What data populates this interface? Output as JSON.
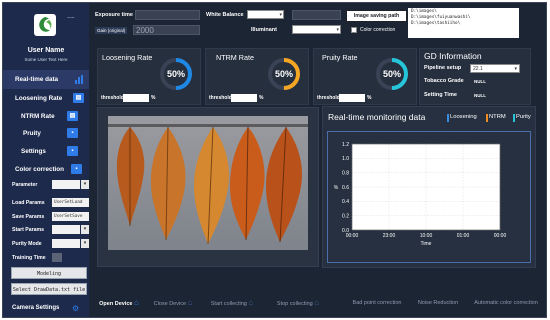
{
  "sidebar": {
    "dots": "........",
    "user_name": "User Name",
    "user_subtitle": "Some User Text Here",
    "nav": [
      {
        "label": "Real-time data",
        "icon": "chart-icon"
      },
      {
        "label": "Loosening Rate",
        "icon": "image-icon"
      },
      {
        "label": "NTRM Rate",
        "icon": "image-icon"
      },
      {
        "label": "Pruity",
        "icon": "square-icon"
      },
      {
        "label": "Settings",
        "icon": "square-icon"
      },
      {
        "label": "Color correction",
        "icon": "square-icon"
      }
    ],
    "params": [
      {
        "label": "Parameter",
        "value": ""
      },
      {
        "label": "Load Params",
        "value": "UserSetLoad"
      },
      {
        "label": "Save Params",
        "value": "UserSetSave"
      },
      {
        "label": "Start Params",
        "value": ""
      },
      {
        "label": "Purity Mode",
        "value": ""
      },
      {
        "label": "Training Time",
        "value": ""
      }
    ],
    "modeling_button": "Modeling",
    "select_button": "Select DrawData.txt file",
    "camera_settings": "Camera Settings"
  },
  "topbar": {
    "exposure_label": "Exposure time",
    "exposure_value": "",
    "white_balance_label": "White Balance",
    "gain_label": "Gain (original)",
    "gain_value": "2000",
    "illuminant_label": "Illuminant",
    "save_path_button": "Image saving path",
    "color_correction_label": "Color correction",
    "paths": [
      "D:\\images\\",
      "D:\\images\\fuiyuanwashi\\",
      "D:\\images\\tashiiho\\"
    ]
  },
  "rates": [
    {
      "title": "Loosening Rate",
      "value": "50%",
      "percent": 50,
      "threshold_label": "threshold",
      "unit": "%"
    },
    {
      "title": "NTRM Rate",
      "value": "50%",
      "percent": 50,
      "threshold_label": "threshold",
      "unit": "%"
    },
    {
      "title": "Pruity Rate",
      "value": "50%",
      "percent": 50,
      "threshold_label": "threshold",
      "unit": "%"
    }
  ],
  "gd": {
    "title": "GD Information",
    "pipeline_label": "Pipeline setup",
    "pipeline_value": "22.1",
    "grade_label": "Tobacco Grade",
    "grade_value": "NULL",
    "setting_label": "Setting Time",
    "setting_value": "NULL"
  },
  "chart_data": {
    "type": "line",
    "title": "Real-time monitoring data",
    "legend": [
      "Loosening",
      "NTRM",
      "Purity"
    ],
    "legend_colors": [
      "#3b8de0",
      "#f08c1e",
      "#27c3d6"
    ],
    "xlabel": "Time",
    "ylabel": "%",
    "x_ticks": [
      "00:00",
      "23:00",
      "10:00",
      "01:00",
      "00:00"
    ],
    "y_ticks": [
      "1.2",
      "1.0",
      "0.8",
      "0.6",
      "0.4",
      "0.2",
      "0.0"
    ],
    "ylim": [
      0,
      1.2
    ],
    "grid": true,
    "series": []
  },
  "bottom": {
    "buttons": [
      "Open Device",
      "Close Device",
      "Start collecting",
      "Stop collecting",
      "Bad point correction",
      "Noise Reduction",
      "Automatic color correction"
    ]
  },
  "colors": {
    "accent": "#2f7be8",
    "background": "#1c2533",
    "sidebar": "#1d2a4c"
  }
}
